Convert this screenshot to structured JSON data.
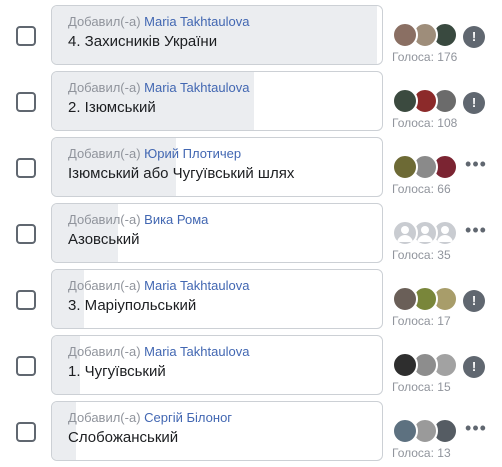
{
  "added_by_prefix": "Добавил(-а)",
  "votes_prefix": "Голоса:",
  "colors": {
    "author": "#4267b2",
    "muted": "#90949c",
    "text": "#1c1e21",
    "bar": "#ebedf0"
  },
  "options": [
    {
      "author": "Maria Takhtaulova",
      "label": "4. Захисників України",
      "votes": 176,
      "vote_share": 1.0,
      "action": "report-icon",
      "voters": [
        "#8a6f63",
        "#9e8d7a",
        "#39493f"
      ]
    },
    {
      "author": "Maria Takhtaulova",
      "label": "2. Ізюмський",
      "votes": 108,
      "vote_share": 0.61,
      "action": "report-icon",
      "voters": [
        "#3b4a3f",
        "#8c2a2a",
        "#6b6b6b"
      ]
    },
    {
      "author": "Юрий Плотичер",
      "label": "Ізюмський або Чугуївський шлях",
      "votes": 66,
      "vote_share": 0.375,
      "action": "more-icon",
      "voters": [
        "#6d6a35",
        "#8a8a8a",
        "#7b2432"
      ]
    },
    {
      "author": "Вика Рома",
      "label": "Азовський",
      "votes": 35,
      "vote_share": 0.2,
      "action": "more-icon",
      "voters": [
        "#c9ccd1",
        "#c9ccd1",
        "#c9ccd1"
      ]
    },
    {
      "author": "Maria Takhtaulova",
      "label": "3. Маріупольський",
      "votes": 17,
      "vote_share": 0.097,
      "action": "report-icon",
      "voters": [
        "#6a5f58",
        "#79863a",
        "#a89d6a"
      ]
    },
    {
      "author": "Maria Takhtaulova",
      "label": "1. Чугуївський",
      "votes": 15,
      "vote_share": 0.085,
      "action": "report-icon",
      "voters": [
        "#2e2e2e",
        "#8d8d8d",
        "#a2a2a2"
      ]
    },
    {
      "author": "Сергій Білоног",
      "label": "Слобожанський",
      "votes": 13,
      "vote_share": 0.074,
      "action": "more-icon",
      "voters": [
        "#5d7180",
        "#9a9a9a",
        "#555c63"
      ]
    }
  ]
}
